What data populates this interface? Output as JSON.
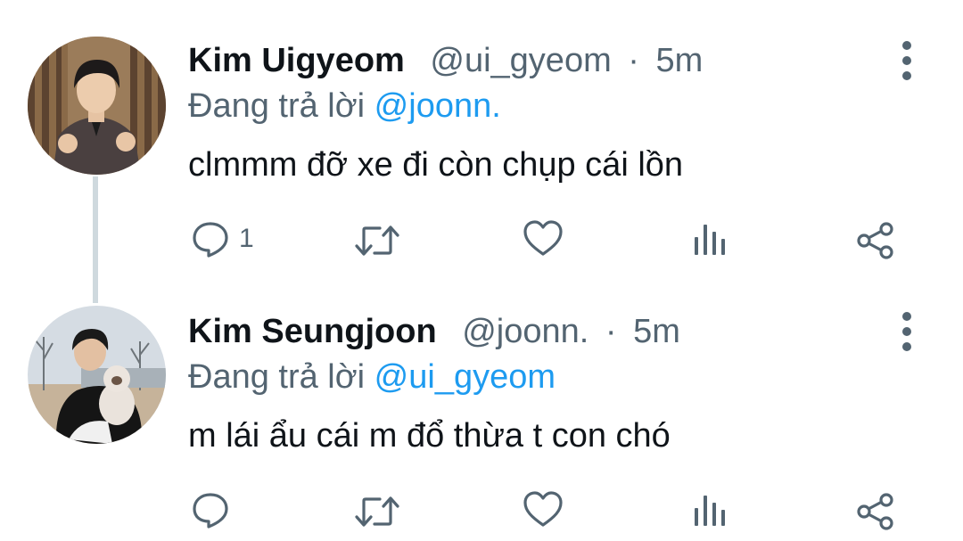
{
  "tweets": [
    {
      "name": "Kim Uigyeom",
      "handle": "@ui_gyeom",
      "separator": "·",
      "time": "5m",
      "reply_prefix": "Đang trả lời",
      "reply_to": "@joonn.",
      "text": "clmmm đỡ xe đi còn chụp cái lồn",
      "replies": "1"
    },
    {
      "name": "Kim Seungjoon",
      "handle": "@joonn.",
      "separator": "·",
      "time": "5m",
      "reply_prefix": "Đang trả lời",
      "reply_to": "@ui_gyeom",
      "text": "m lái ẩu cái m đổ thừa t con chó",
      "replies": ""
    }
  ],
  "icons": {
    "reply": "comment-bubble-icon",
    "retweet": "retweet-icon",
    "like": "heart-icon",
    "analytics": "bar-chart-icon",
    "share": "share-icon",
    "more": "vertical-dots-icon"
  },
  "colors": {
    "text": "#0f1419",
    "secondary": "#536471",
    "link": "#1d9bf0",
    "thread_line": "#cfd9de"
  }
}
